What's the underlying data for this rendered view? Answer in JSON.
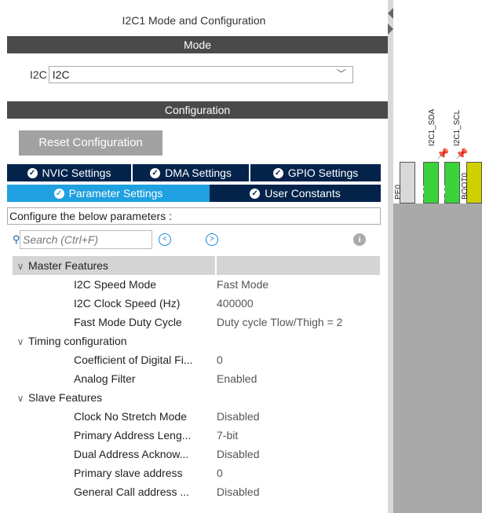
{
  "panel": {
    "title": "I2C1 Mode and Configuration",
    "mode_header": "Mode",
    "i2c_label": "I2C",
    "i2c_value": "I2C",
    "config_header": "Configuration",
    "reset_button": "Reset Configuration"
  },
  "tabs": {
    "nvic": "NVIC Settings",
    "dma": "DMA Settings",
    "gpio": "GPIO Settings",
    "params": "Parameter Settings",
    "constants": "User Constants"
  },
  "description": "Configure the below parameters :",
  "search": {
    "placeholder": "Search (Ctrl+F)"
  },
  "groups": [
    {
      "name": "Master Features",
      "params": [
        {
          "key": "I2C Speed Mode",
          "value": "Fast Mode"
        },
        {
          "key": "I2C Clock Speed (Hz)",
          "value": "400000"
        },
        {
          "key": "Fast Mode Duty Cycle",
          "value": "Duty cycle Tlow/Thigh = 2"
        }
      ]
    },
    {
      "name": "Timing configuration",
      "params": [
        {
          "key": "Coefficient of Digital Fi...",
          "value": "0"
        },
        {
          "key": "Analog Filter",
          "value": "Enabled"
        }
      ]
    },
    {
      "name": "Slave Features",
      "params": [
        {
          "key": "Clock No Stretch Mode",
          "value": "Disabled"
        },
        {
          "key": "Primary Address Leng...",
          "value": "7-bit"
        },
        {
          "key": "Dual Address Acknow...",
          "value": "Disabled"
        },
        {
          "key": "Primary slave address",
          "value": "0"
        },
        {
          "key": "General Call address ...",
          "value": "Disabled"
        }
      ]
    }
  ],
  "pinout": {
    "signals": [
      "I2C1_SDA",
      "I2C1_SCL"
    ],
    "pins": [
      "PE0",
      "PB9",
      "PB8",
      "BOOT0"
    ],
    "colors": {
      "assigned": "#3bd23b",
      "unassigned": "#d8d8d8",
      "boot": "#d0d000"
    }
  },
  "colors": {
    "tab_dark": "#03234b",
    "tab_active": "#1fa0e0",
    "header_bar": "#4a4a4a"
  }
}
